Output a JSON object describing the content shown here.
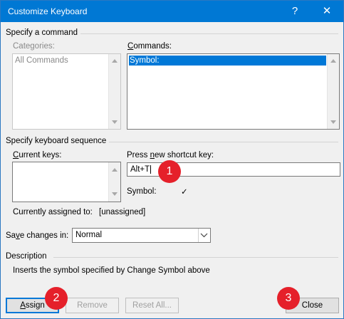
{
  "window": {
    "title": "Customize Keyboard",
    "help_glyph": "?",
    "close_glyph": "✕"
  },
  "command_section": {
    "heading": "Specify a command",
    "categories_label": "Categories:",
    "categories_items": [
      "All Commands"
    ],
    "commands_label": "Commands:",
    "commands_items": [
      "Symbol:"
    ]
  },
  "keyboard_section": {
    "heading": "Specify keyboard sequence",
    "current_keys_label": "Current keys:",
    "new_shortcut_label": "Press new shortcut key:",
    "new_shortcut_value": "Alt+T",
    "symbol_label": "Symbol:",
    "symbol_value": "✓",
    "assigned_label": "Currently assigned to:",
    "assigned_value": "[unassigned]"
  },
  "save": {
    "label": "Save changes in:",
    "selected": "Normal"
  },
  "description": {
    "heading": "Description",
    "text": "Inserts the symbol specified by Change Symbol above"
  },
  "buttons": {
    "assign": "Assign",
    "remove": "Remove",
    "reset_all": "Reset All...",
    "close": "Close"
  },
  "badges": [
    "1",
    "2",
    "3"
  ],
  "colors": {
    "titlebar": "#0078d4",
    "selection": "#0078d7",
    "badge": "#e5202a"
  }
}
